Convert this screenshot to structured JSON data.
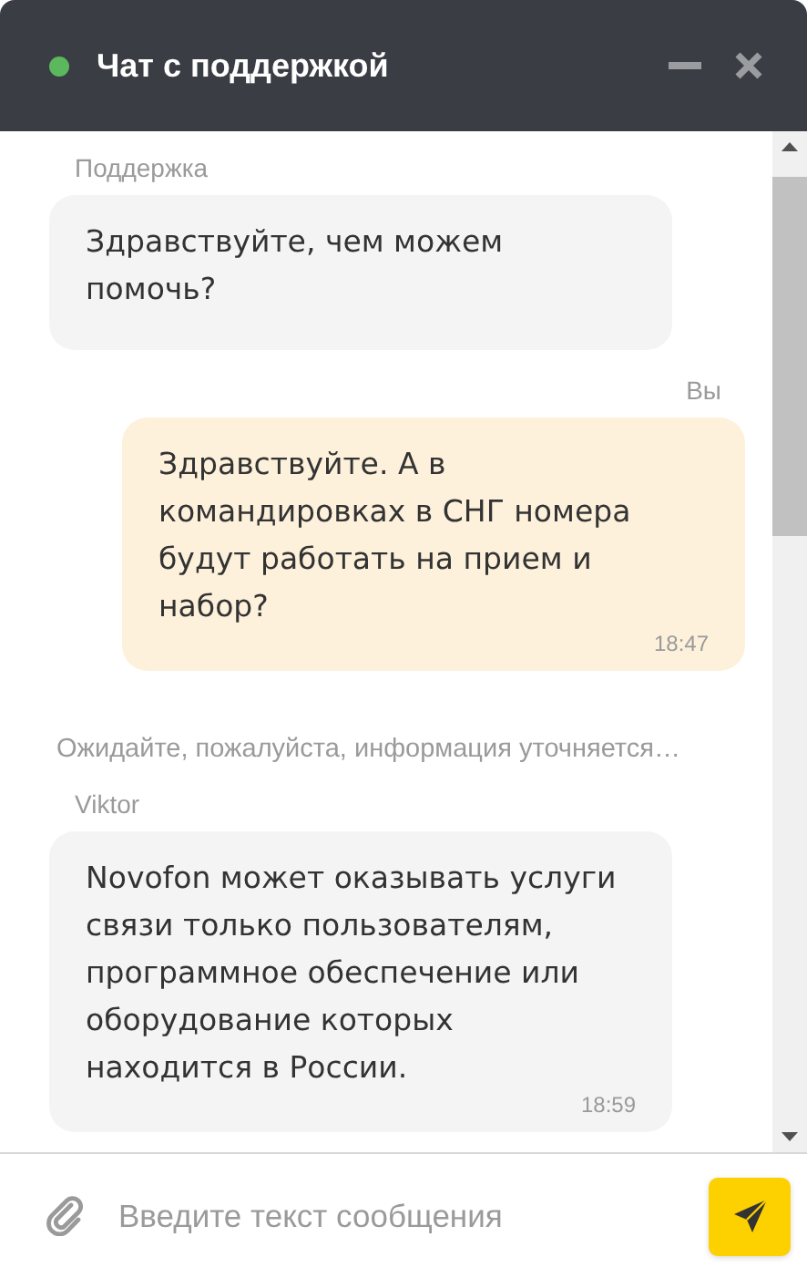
{
  "header": {
    "title": "Чат с поддержкой",
    "online": true
  },
  "messages": [
    {
      "kind": "message",
      "sender": "Поддержка",
      "own": false,
      "text": "Здравствуйте, чем можем помочь?"
    },
    {
      "kind": "message",
      "sender": "Вы",
      "own": true,
      "text": "Здравствуйте. А в командировках в СНГ номера будут работать на прием и набор?",
      "time": "18:47"
    },
    {
      "kind": "notice",
      "text": "Ожидайте, пожалуйста, информация уточняется…"
    },
    {
      "kind": "message",
      "sender": "Viktor",
      "own": false,
      "text": "Novofon может оказывать услуги связи только пользователям, программное обеспечение или оборудование которых находится в России.",
      "time": "18:59"
    }
  ],
  "composer": {
    "placeholder": "Введите текст сообщения"
  }
}
